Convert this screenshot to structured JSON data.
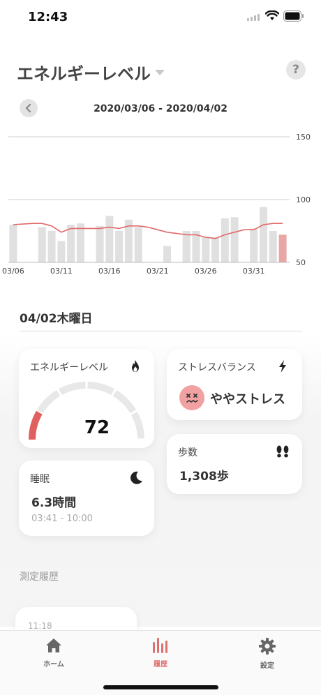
{
  "status_bar": {
    "time": "12:43"
  },
  "header": {
    "title": "エネルギーレベル",
    "help_label": "?"
  },
  "date_nav": {
    "range": "2020/03/06 - 2020/04/02"
  },
  "chart_data": {
    "type": "bar",
    "ylim": [
      50,
      150
    ],
    "y_ticks": [
      "150",
      "100",
      "50"
    ],
    "x_ticks": [
      "03/06",
      "03/11",
      "03/16",
      "03/21",
      "03/26",
      "03/31"
    ],
    "categories": [
      "03/06",
      "03/07",
      "03/08",
      "03/09",
      "03/10",
      "03/11",
      "03/12",
      "03/13",
      "03/14",
      "03/15",
      "03/16",
      "03/17",
      "03/18",
      "03/19",
      "03/20",
      "03/21",
      "03/22",
      "03/23",
      "03/24",
      "03/25",
      "03/26",
      "03/27",
      "03/28",
      "03/29",
      "03/30",
      "03/31",
      "04/01",
      "04/02"
    ],
    "series": [
      {
        "values": [
          80,
          null,
          null,
          78,
          75,
          67,
          80,
          81,
          null,
          79,
          87,
          75,
          84,
          78,
          null,
          null,
          63,
          null,
          75,
          75,
          70,
          70,
          85,
          86,
          null,
          77,
          94,
          75,
          72
        ]
      },
      {
        "values": [
          80,
          80.5,
          81,
          81,
          79,
          74,
          77,
          77,
          77,
          77,
          78,
          77,
          79,
          79,
          78,
          76,
          74,
          73,
          72,
          72,
          70,
          69,
          72,
          74,
          76,
          76,
          80,
          81,
          81
        ]
      }
    ],
    "colors": {
      "bar": "#e0e0e0",
      "bar_selected": "#e8a6a6",
      "line": "#e26a6a",
      "grid": "#cfcfcf"
    }
  },
  "day": {
    "title": "04/02木曜日"
  },
  "cards": {
    "energy": {
      "label": "エネルギーレベル",
      "value": "72",
      "level": 0.72
    },
    "stress": {
      "label": "ストレスバランス",
      "value": "ややストレス"
    },
    "steps": {
      "label": "歩数",
      "value": "1,308歩"
    },
    "sleep": {
      "label": "睡眠",
      "value": "6.3時間",
      "range": "03:41 - 10:00"
    }
  },
  "history": {
    "title": "測定履歴",
    "first_time": "11:18"
  },
  "tabs": [
    {
      "label": "ホーム"
    },
    {
      "label": "履歴"
    },
    {
      "label": "設定"
    }
  ],
  "accent": "#e07070"
}
